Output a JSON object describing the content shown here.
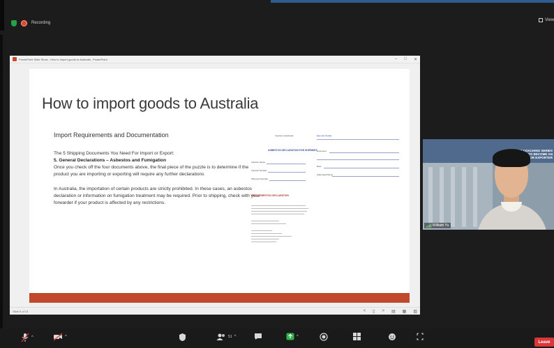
{
  "meeting": {
    "recording_label": "Recording",
    "view_label": "View"
  },
  "share_window": {
    "title": "PowerPoint Slide Show - How to import goods to Australia - PowerPoint",
    "controls": [
      "–",
      "□",
      "✕"
    ],
    "status_left": "Slide 5 of 13",
    "status_icons": [
      "<",
      "▯",
      ">",
      "▤",
      "▦",
      "▥"
    ]
  },
  "slide": {
    "title": "How to import goods to Australia",
    "subtitle": "Import Requirements and Documentation",
    "line1": "The 5 Shipping Documents You Need For Import or Export:",
    "bold_line": "5. General Declarations – Asbestos and Fumigation",
    "para1": "Once you check off the four documents above, the final piece of the puzzle is to determine if the product you are importing or exporting will require any further declarations",
    "para2": "In Australia, the importation of certain products are strictly prohibited. In these cases, an asbestos declaration or information on fumigation treatment may be required. Prior to shipping, check with your forwarder if your product is affected by any restrictions.",
    "accent_color": "#c0492b"
  },
  "doc_image": {
    "heading": "ASBESTOS DECLARATION FOR SHIPMENT",
    "section": "FREE ASBESTOS DECLARATION",
    "fields_left": [
      "Importer Name",
      "Importer Number",
      "Shipment Number"
    ],
    "fields_right": [
      "Document",
      "Date",
      "Authorised Name"
    ],
    "top_left": "Importer Letterhead",
    "top_right": "Exporter Details"
  },
  "participant": {
    "name": "William Yu",
    "banner_text": "BUSINESS COACHING SERIES HOW TO BECOME AN IMPORTER OR EXPORTER"
  },
  "toolbar": {
    "participants_count": "51",
    "leave_label": "Leave"
  }
}
